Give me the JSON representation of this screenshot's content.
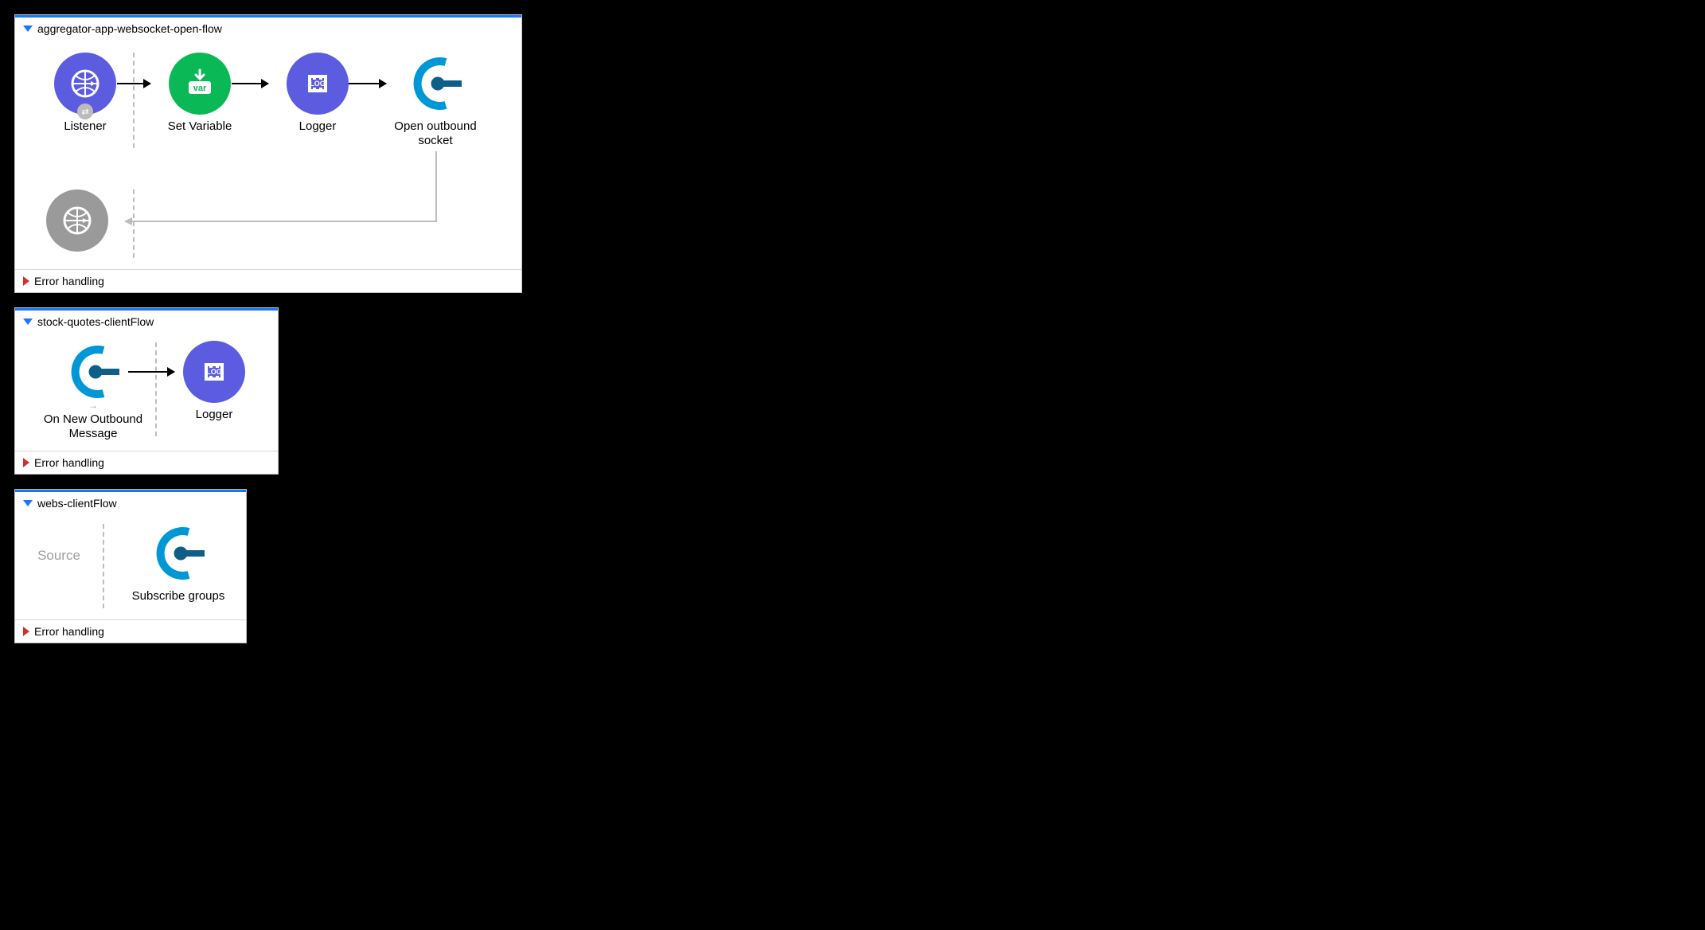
{
  "flows": [
    {
      "title": "aggregator-app-websocket-open-flow",
      "error_label": "Error handling",
      "nodes": {
        "listener": "Listener",
        "set_variable": "Set Variable",
        "logger": "Logger",
        "open_socket": "Open outbound socket"
      }
    },
    {
      "title": "stock-quotes-clientFlow",
      "error_label": "Error handling",
      "nodes": {
        "on_new_outbound": "On New Outbound Message",
        "logger": "Logger"
      }
    },
    {
      "title": "webs-clientFlow",
      "error_label": "Error handling",
      "source_placeholder": "Source",
      "nodes": {
        "subscribe": "Subscribe groups"
      }
    }
  ]
}
